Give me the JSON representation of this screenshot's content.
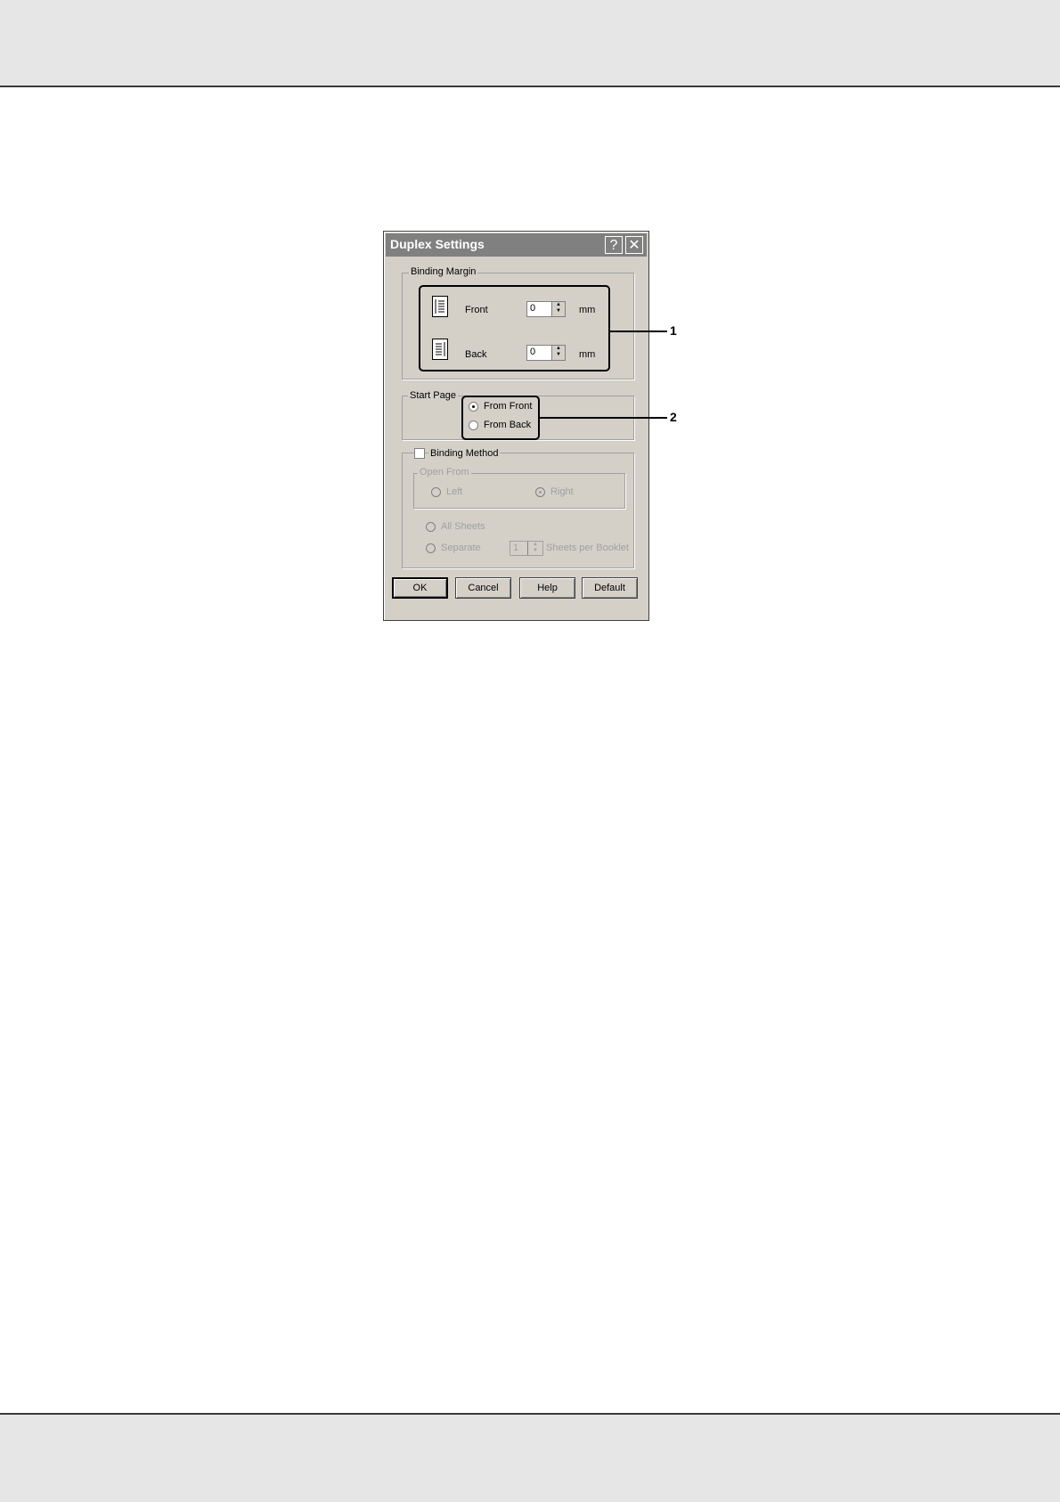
{
  "dialog": {
    "title": "Duplex Settings",
    "help_icon": "question-mark",
    "close_icon": "x"
  },
  "binding_margin": {
    "legend": "Binding Margin",
    "front": {
      "label": "Front",
      "value": "0",
      "unit": "mm",
      "icon": "page-binding-left-icon"
    },
    "back": {
      "label": "Back",
      "value": "0",
      "unit": "mm",
      "icon": "page-binding-right-icon"
    }
  },
  "start_page": {
    "legend": "Start Page",
    "options": [
      {
        "label": "From Front",
        "checked": true
      },
      {
        "label": "From Back",
        "checked": false
      }
    ]
  },
  "binding_method": {
    "checkbox_label": "Binding Method",
    "checked": false,
    "open_from": {
      "legend": "Open From",
      "left_label": "Left",
      "right_label": "Right",
      "selected": "Right"
    },
    "all_sheets_label": "All Sheets",
    "separate_label": "Separate",
    "sheets_value": "1",
    "sheets_per_booklet_label": "Sheets per Booklet"
  },
  "buttons": {
    "ok": "OK",
    "cancel": "Cancel",
    "help": "Help",
    "default": "Default"
  },
  "callouts": [
    "1",
    "2"
  ]
}
